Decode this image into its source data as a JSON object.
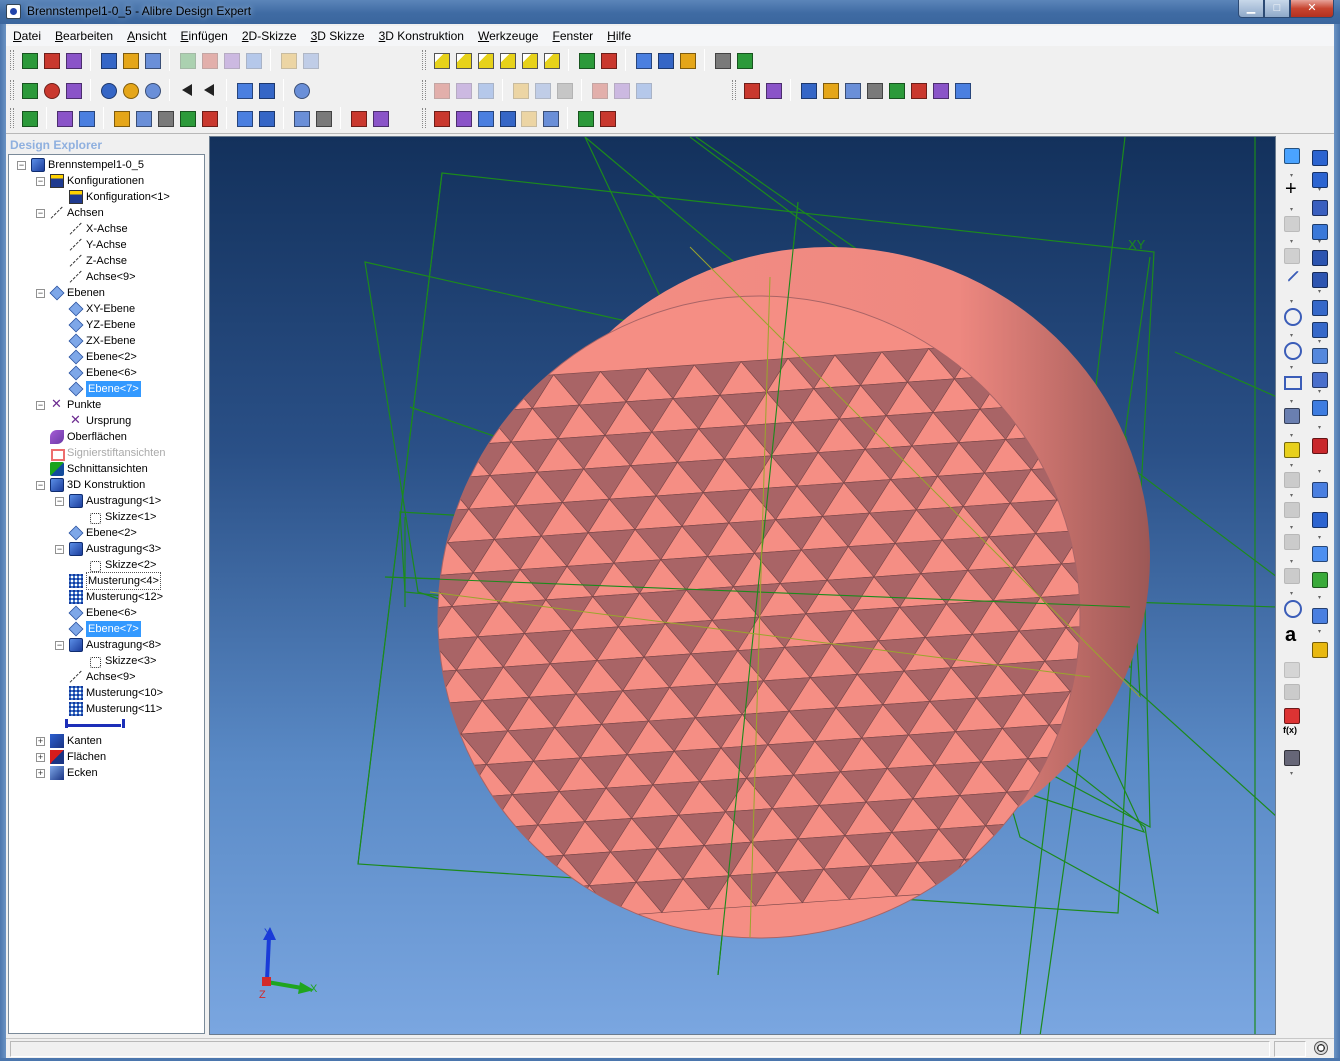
{
  "window": {
    "title": "Brennstempel1-0_5 - Alibre Design Expert",
    "minimize": "▁",
    "maximize": "□",
    "close": "✕"
  },
  "menu": [
    {
      "pre": "",
      "u": "D",
      "post": "atei"
    },
    {
      "pre": "",
      "u": "B",
      "post": "earbeiten"
    },
    {
      "pre": "",
      "u": "A",
      "post": "nsicht"
    },
    {
      "pre": "",
      "u": "E",
      "post": "infügen"
    },
    {
      "pre": "",
      "u": "2",
      "post": "D-Skizze"
    },
    {
      "pre": "",
      "u": "3",
      "post": "D Skizze"
    },
    {
      "pre": "",
      "u": "3",
      "post": "D Konstruktion"
    },
    {
      "pre": "",
      "u": "W",
      "post": "erkzeuge"
    },
    {
      "pre": "",
      "u": "F",
      "post": "enster"
    },
    {
      "pre": "",
      "u": "H",
      "post": "ilfe"
    }
  ],
  "explorer": {
    "header": "Design Explorer",
    "tree": [
      {
        "label": "Brennstempel1-0_5",
        "icon": "feat",
        "level": 0,
        "expander": "−",
        "state": ""
      },
      {
        "label": "Konfigurationen",
        "icon": "cfg",
        "level": 1,
        "expander": "−",
        "state": ""
      },
      {
        "label": "Konfiguration<1>",
        "icon": "cfg",
        "level": 2,
        "expander": "",
        "state": ""
      },
      {
        "label": "Achsen",
        "icon": "axis",
        "level": 1,
        "expander": "−",
        "state": ""
      },
      {
        "label": "X-Achse",
        "icon": "axis",
        "level": 2,
        "expander": "",
        "state": ""
      },
      {
        "label": "Y-Achse",
        "icon": "axis",
        "level": 2,
        "expander": "",
        "state": ""
      },
      {
        "label": "Z-Achse",
        "icon": "axis",
        "level": 2,
        "expander": "",
        "state": ""
      },
      {
        "label": "Achse<9>",
        "icon": "axis",
        "level": 2,
        "expander": "",
        "state": ""
      },
      {
        "label": "Ebenen",
        "icon": "plane",
        "level": 1,
        "expander": "−",
        "state": ""
      },
      {
        "label": "XY-Ebene",
        "icon": "plane",
        "level": 2,
        "expander": "",
        "state": ""
      },
      {
        "label": "YZ-Ebene",
        "icon": "plane",
        "level": 2,
        "expander": "",
        "state": ""
      },
      {
        "label": "ZX-Ebene",
        "icon": "plane",
        "level": 2,
        "expander": "",
        "state": ""
      },
      {
        "label": "Ebene<2>",
        "icon": "plane",
        "level": 2,
        "expander": "",
        "state": ""
      },
      {
        "label": "Ebene<6>",
        "icon": "plane",
        "level": 2,
        "expander": "",
        "state": ""
      },
      {
        "label": "Ebene<7>",
        "icon": "plane",
        "level": 2,
        "expander": "",
        "state": "selected"
      },
      {
        "label": "Punkte",
        "icon": "point",
        "level": 1,
        "expander": "−",
        "state": ""
      },
      {
        "label": "Ursprung",
        "icon": "point",
        "level": 2,
        "expander": "",
        "state": ""
      },
      {
        "label": "Oberflächen",
        "icon": "surf",
        "level": 1,
        "expander": "",
        "state": ""
      },
      {
        "label": "Signierstiftansichten",
        "icon": "pin",
        "level": 1,
        "expander": "",
        "state": "disabled"
      },
      {
        "label": "Schnittansichten",
        "icon": "section",
        "level": 1,
        "expander": "",
        "state": ""
      },
      {
        "label": "3D Konstruktion",
        "icon": "feat",
        "level": 1,
        "expander": "−",
        "state": ""
      },
      {
        "label": "Austragung<1>",
        "icon": "feat",
        "level": 2,
        "expander": "−",
        "state": ""
      },
      {
        "label": "Skizze<1>",
        "icon": "sketch",
        "level": 3,
        "expander": "",
        "state": ""
      },
      {
        "label": "Ebene<2>",
        "icon": "plane",
        "level": 2,
        "expander": "",
        "state": ""
      },
      {
        "label": "Austragung<3>",
        "icon": "feat",
        "level": 2,
        "expander": "−",
        "state": ""
      },
      {
        "label": "Skizze<2>",
        "icon": "sketch",
        "level": 3,
        "expander": "",
        "state": ""
      },
      {
        "label": "Musterung<4>",
        "icon": "pattern",
        "level": 2,
        "expander": "",
        "state": "boxed"
      },
      {
        "label": "Musterung<12>",
        "icon": "pattern",
        "level": 2,
        "expander": "",
        "state": ""
      },
      {
        "label": "Ebene<6>",
        "icon": "plane",
        "level": 2,
        "expander": "",
        "state": ""
      },
      {
        "label": "Ebene<7>",
        "icon": "plane",
        "level": 2,
        "expander": "",
        "state": "selected"
      },
      {
        "label": "Austragung<8>",
        "icon": "feat",
        "level": 2,
        "expander": "−",
        "state": ""
      },
      {
        "label": "Skizze<3>",
        "icon": "sketch",
        "level": 3,
        "expander": "",
        "state": ""
      },
      {
        "label": "Achse<9>",
        "icon": "axis",
        "level": 2,
        "expander": "",
        "state": ""
      },
      {
        "label": "Musterung<10>",
        "icon": "pattern",
        "level": 2,
        "expander": "",
        "state": ""
      },
      {
        "label": "Musterung<11>",
        "icon": "pattern",
        "level": 2,
        "expander": "",
        "state": ""
      },
      {
        "label": "",
        "icon": "",
        "level": 2,
        "expander": "",
        "state": "end"
      },
      {
        "label": "Kanten",
        "icon": "edges",
        "level": 1,
        "expander": "+",
        "state": ""
      },
      {
        "label": "Flächen",
        "icon": "faces",
        "level": 1,
        "expander": "+",
        "state": ""
      },
      {
        "label": "Ecken",
        "icon": "corners",
        "level": 1,
        "expander": "+",
        "state": ""
      }
    ]
  },
  "viewport": {
    "triad": {
      "y": "Y",
      "x": "X",
      "z": "Z"
    },
    "plane_label": "XY",
    "colors": {
      "face_light": "#f58e84",
      "face_dark": "#a96466",
      "cylinder": "#f3877e",
      "cylinder_shade": "#a55a58",
      "plane_lines": "#1c8a1c",
      "axis_lines": "#9aa52c"
    }
  },
  "toolbars": {
    "row1": [
      "new-part-icon",
      "open-icon",
      "save-icon",
      "sep",
      "print-preview-icon",
      "print-setup-icon",
      "print-icon",
      "sep",
      "cut-icon",
      "copy-icon",
      "paste-icon",
      "delete-icon",
      "sep",
      "undo-icon",
      "redo-icon"
    ],
    "row1b": [
      "view-front-icon",
      "view-back-icon",
      "view-top-icon",
      "view-bottom-icon",
      "view-left-icon",
      "view-right-icon",
      "sep",
      "rotate-ccw-icon",
      "rotate-cw-icon",
      "sep",
      "snap-grid-icon",
      "measure-icon",
      "sketch-plane-icon",
      "sep",
      "regen-icon",
      "constraint-icon"
    ],
    "row2": [
      "select-icon",
      "pan-icon",
      "rotate-icon",
      "sep",
      "zoom-in-icon",
      "zoom-window-icon",
      "zoom-fit-icon",
      "sep",
      "prev-view-icon",
      "next-view-icon",
      "sep",
      "section-icon",
      "display-icon",
      "sep",
      "render-icon"
    ],
    "row2b": [
      "linear-dim-icon",
      "angular-dim-icon",
      "radial-dim-icon",
      "sep",
      "trim-icon",
      "extend-icon",
      "offset-icon",
      "sep",
      "mirror-icon",
      "pattern-grid-icon",
      "table-icon"
    ],
    "row2c": [
      "extrude-icon",
      "revolve-icon",
      "sep",
      "loft-icon",
      "sweep-icon",
      "hole-icon",
      "fillet-icon",
      "chamfer-icon",
      "shell-icon",
      "draft-icon",
      "scale-icon"
    ],
    "row3": [
      "feature-icon",
      "sep",
      "solid-icon",
      "isometric-icon",
      "sep",
      "plane-cmd-icon",
      "axis-cmd-icon",
      "point-cmd-icon",
      "surface-cmd-icon",
      "sketch-cmd-icon",
      "sep",
      "mate-icon",
      "align-icon",
      "sep",
      "analyze-icon",
      "mass-icon",
      "sep",
      "bom-icon",
      "report-icon"
    ],
    "row3b": [
      "insert-plane-icon",
      "insert-axis-icon",
      "insert-point-icon",
      "surface-icon",
      "config-table-icon",
      "section-view-icon",
      "sep",
      "check-icon",
      "balance-icon"
    ]
  }
}
